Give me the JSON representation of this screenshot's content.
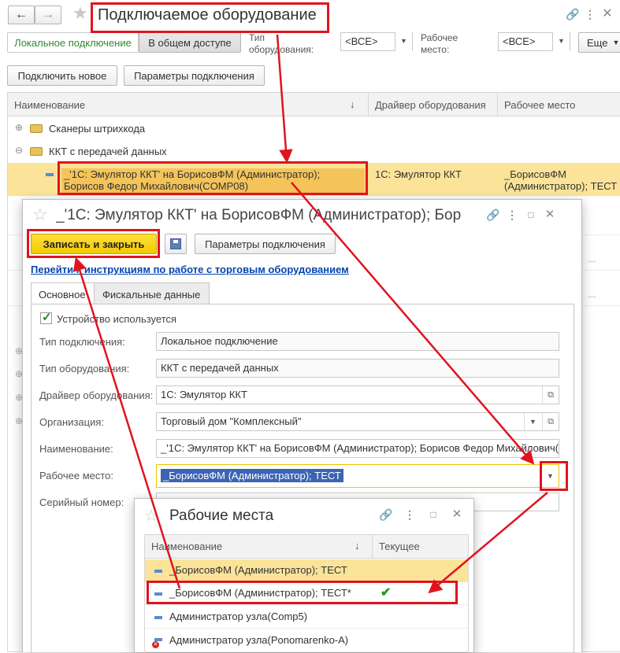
{
  "main": {
    "title": "Подключаемое оборудование",
    "tabs": {
      "local": "Локальное подключение",
      "shared": "В общем доступе"
    },
    "filter_type_label": "Тип\nоборудования:",
    "filter_type_value": "<ВСЕ>",
    "filter_workplace_label": "Рабочее\nместо:",
    "filter_workplace_value": "<ВСЕ>",
    "more_label": "Еще",
    "connect_new": "Подключить новое",
    "conn_params": "Параметры подключения",
    "columns": {
      "name": "Наименование",
      "sort": "↓",
      "driver": "Драйвер оборудования",
      "workplace": "Рабочее место"
    },
    "groups": [
      {
        "label": "Сканеры штрихкода",
        "toggle": "⊕"
      },
      {
        "label": "ККТ с передачей данных",
        "toggle": "⊖"
      }
    ],
    "selected_row": {
      "name": "_'1С: Эмулятор ККТ' на БорисовФМ (Администратор); Борисов Федор Михайлович(COMP08)",
      "name_line1": "_'1С: Эмулятор ККТ' на БорисовФМ (Администратор);",
      "name_line2": "Борисов Федор Михайлович(COMP08)",
      "driver": "1С: Эмулятор ККТ",
      "workplace_line1": "_БорисовФМ",
      "workplace_line2": "(Администратор); ТЕСТ"
    },
    "ellipsis": "..."
  },
  "form": {
    "title": "_'1С: Эмулятор ККТ' на БорисовФМ (Администратор); Бор",
    "save_close": "Записать и закрыть",
    "conn_params": "Параметры подключения",
    "help_link": "Перейти к инструкциям по работе с торговым оборудованием",
    "tabs": {
      "main": "Основное",
      "fiscal": "Фискальные данные"
    },
    "checkbox_label": "Устройство используется",
    "fields": {
      "conn_type": {
        "label": "Тип подключения:",
        "value": "Локальное подключение"
      },
      "equip_type": {
        "label": "Тип оборудования:",
        "value": "ККТ с передачей данных"
      },
      "driver": {
        "label": "Драйвер оборудования:",
        "value": "1С: Эмулятор ККТ"
      },
      "org": {
        "label": "Организация:",
        "value": "Торговый дом \"Комплексный\""
      },
      "name": {
        "label": "Наименование:",
        "value": "_'1С: Эмулятор ККТ' на БорисовФМ (Администратор); Борисов Федор Михайлович("
      },
      "workplace": {
        "label": "Рабочее место:",
        "value": "_БорисовФМ (Администратор); ТЕСТ"
      },
      "serial": {
        "label": "Серийный номер:",
        "value": ""
      }
    }
  },
  "popup": {
    "title": "Рабочие места",
    "columns": {
      "name": "Наименование",
      "sort": "↓",
      "current": "Текущее"
    },
    "rows": [
      {
        "name": "_БорисовФМ (Администратор); ТЕСТ",
        "current": ""
      },
      {
        "name": "_БорисовФМ (Администратор); ТЕСТ*",
        "current": "✔"
      },
      {
        "name": "Администратор узла(Comp5)",
        "current": ""
      },
      {
        "name": "Администратор узла(Ponomarenko-A)",
        "current": ""
      }
    ]
  },
  "colors": {
    "accent_red": "#e0141e",
    "selection": "#fbe49a",
    "save_button": "#f5d200",
    "link": "#0645ad"
  }
}
